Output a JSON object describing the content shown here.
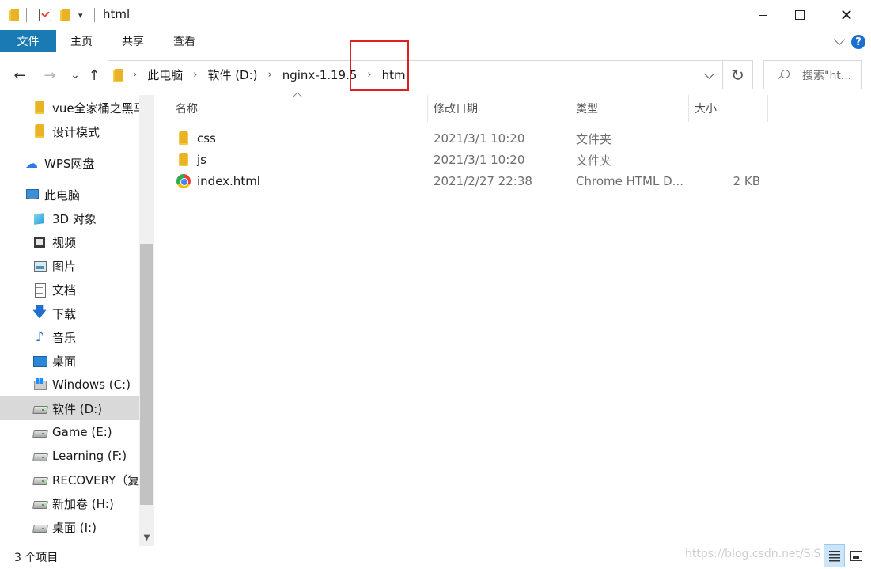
{
  "window": {
    "title": "html",
    "controls": {
      "minimize": "minimize",
      "maximize": "maximize",
      "close": "✕"
    }
  },
  "ribbon": {
    "tabs": [
      "文件",
      "主页",
      "共享",
      "查看"
    ],
    "help": "?"
  },
  "navigation": {
    "back": "←",
    "forward": "→",
    "recent": "⌄",
    "up": "↑",
    "breadcrumbs": [
      "此电脑",
      "软件 (D:)",
      "nginx-1.19.5",
      "html"
    ],
    "refresh": "↻",
    "search_placeholder": "搜索\"ht..."
  },
  "sidebar": {
    "items": [
      {
        "label": "vue全家桶之黑马",
        "icon": "folder-icon"
      },
      {
        "label": "设计模式",
        "icon": "folder-icon"
      },
      {
        "label": "WPS网盘",
        "icon": "cloud-icon"
      },
      {
        "label": "此电脑",
        "icon": "computer-icon"
      },
      {
        "label": "3D 对象",
        "icon": "3d-objects-icon"
      },
      {
        "label": "视频",
        "icon": "video-icon"
      },
      {
        "label": "图片",
        "icon": "pictures-icon"
      },
      {
        "label": "文档",
        "icon": "document-icon"
      },
      {
        "label": "下载",
        "icon": "download-icon"
      },
      {
        "label": "音乐",
        "icon": "music-icon"
      },
      {
        "label": "桌面",
        "icon": "desktop-icon"
      },
      {
        "label": "Windows (C:)",
        "icon": "windows-drive-icon"
      },
      {
        "label": "软件 (D:)",
        "icon": "drive-icon",
        "selected": true
      },
      {
        "label": "Game (E:)",
        "icon": "drive-icon"
      },
      {
        "label": "Learning (F:)",
        "icon": "drive-icon"
      },
      {
        "label": "RECOVERY（复",
        "icon": "drive-icon"
      },
      {
        "label": "新加卷 (H:)",
        "icon": "drive-icon"
      },
      {
        "label": "桌面 (I:)",
        "icon": "drive-icon"
      }
    ]
  },
  "columns": [
    "名称",
    "修改日期",
    "类型",
    "大小"
  ],
  "files": [
    {
      "name": "css",
      "date": "2021/3/1 10:20",
      "type": "文件夹",
      "size": "",
      "icon": "folder-icon"
    },
    {
      "name": "js",
      "date": "2021/3/1 10:20",
      "type": "文件夹",
      "size": "",
      "icon": "folder-icon"
    },
    {
      "name": "index.html",
      "date": "2021/2/27 22:38",
      "type": "Chrome HTML D...",
      "size": "2 KB",
      "icon": "chrome-icon"
    }
  ],
  "status": {
    "count": "3 个项目",
    "watermark": "https://blog.csdn.net/SiS"
  },
  "colors": {
    "file_tab": "#1a7ab3",
    "highlight": "#e02020",
    "selected_nav": "#d9d9d9"
  }
}
